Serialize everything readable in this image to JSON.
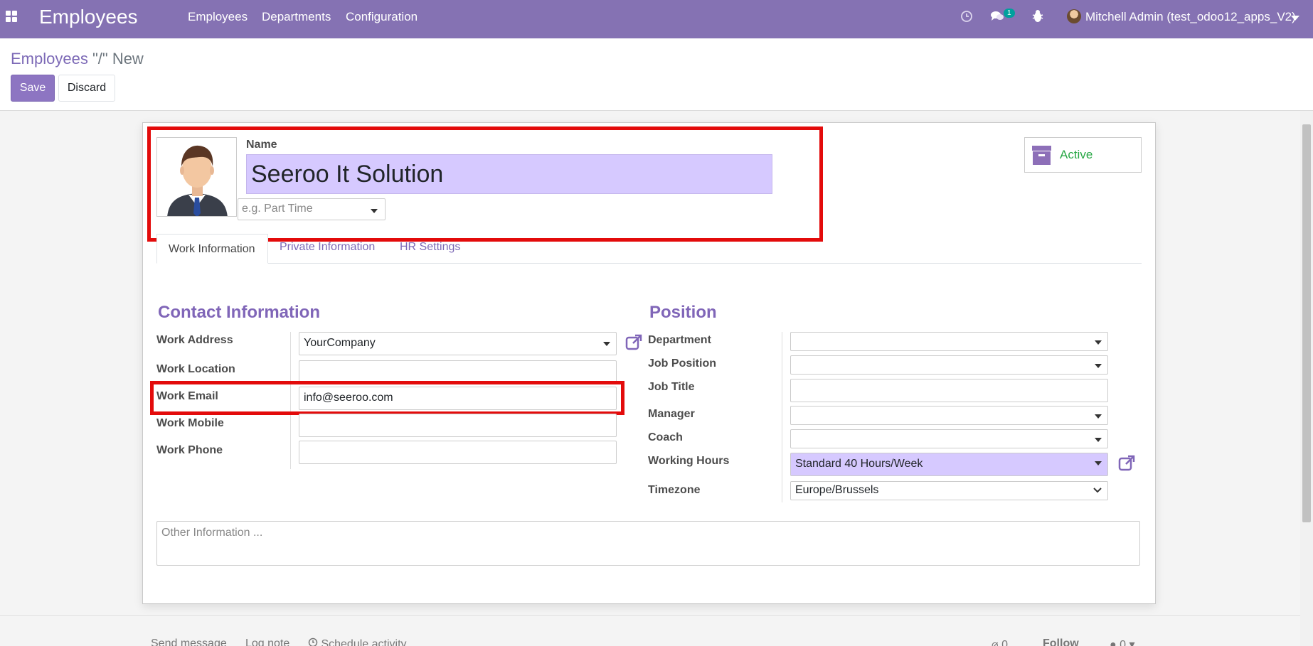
{
  "navbar": {
    "app_title": "Employees",
    "menu": [
      "Employees",
      "Departments",
      "Configuration"
    ],
    "messages_count": "1",
    "user": "Mitchell Admin (test_odoo12_apps_V2)"
  },
  "breadcrumb": {
    "parent": "Employees",
    "current": "\"/\" New"
  },
  "buttons": {
    "save": "Save",
    "discard": "Discard"
  },
  "form": {
    "name_label": "Name",
    "name_value": "Seeroo It Solution",
    "tag_placeholder": "e.g. Part Time",
    "active_label": "Active",
    "tabs": [
      "Work Information",
      "Private Information",
      "HR Settings"
    ],
    "contact": {
      "title": "Contact Information",
      "work_address_label": "Work Address",
      "work_address_value": "YourCompany",
      "work_location_label": "Work Location",
      "work_location_value": "",
      "work_email_label": "Work Email",
      "work_email_value": "info@seeroo.com",
      "work_mobile_label": "Work Mobile",
      "work_mobile_value": "",
      "work_phone_label": "Work Phone",
      "work_phone_value": ""
    },
    "position": {
      "title": "Position",
      "department_label": "Department",
      "department_value": "",
      "job_position_label": "Job Position",
      "job_position_value": "",
      "job_title_label": "Job Title",
      "job_title_value": "",
      "manager_label": "Manager",
      "manager_value": "",
      "coach_label": "Coach",
      "coach_value": "",
      "working_hours_label": "Working Hours",
      "working_hours_value": "Standard 40 Hours/Week",
      "timezone_label": "Timezone",
      "timezone_value": "Europe/Brussels"
    },
    "other_info_placeholder": "Other Information ..."
  },
  "chatter": {
    "send_message": "Send message",
    "log_note": "Log note",
    "schedule_activity": "Schedule activity",
    "attachments": "0",
    "follow": "Follow",
    "followers": "0"
  },
  "colors": {
    "navbar": "#8572b3",
    "accent": "#7c69b6",
    "highlight": "#d6c9ff",
    "annotation_red": "#e30b0b",
    "active_green": "#28a745"
  }
}
